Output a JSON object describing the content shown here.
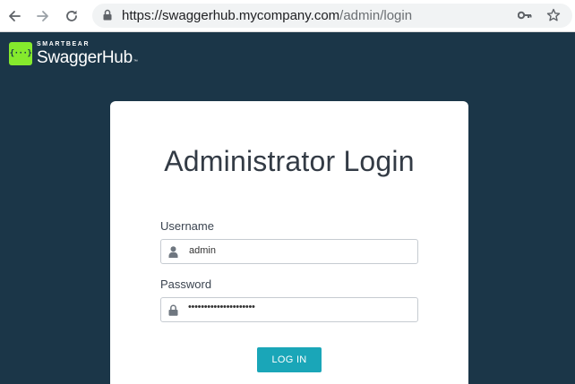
{
  "browser": {
    "url_host": "https://swaggerhub.mycompany.com",
    "url_path": "/admin/login",
    "icons": [
      "back-arrow-icon",
      "forward-arrow-icon",
      "reload-icon",
      "lock-icon",
      "key-icon",
      "star-icon"
    ]
  },
  "header": {
    "logo_brand_top": "SMARTBEAR",
    "logo_brand_main": "SwaggerHub",
    "logo_tm": "™",
    "logo_mark": "{···}"
  },
  "login": {
    "title": "Administrator Login",
    "username_label": "Username",
    "username_value": "admin",
    "password_label": "Password",
    "password_masked": "•••••••••••••••••••••",
    "submit_label": "LOG IN"
  },
  "colors": {
    "page_background": "#1b3648",
    "card_background": "#ffffff",
    "button_accent": "#1aa6b8",
    "logo_green": "#85ea2d"
  }
}
